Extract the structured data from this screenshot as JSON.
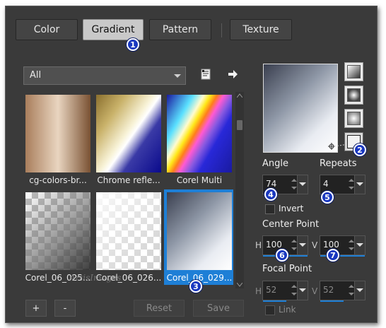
{
  "tabs": [
    {
      "label": "Color",
      "active": false
    },
    {
      "label": "Gradient",
      "active": true
    },
    {
      "label": "Pattern",
      "active": false
    },
    {
      "label": "Texture",
      "active": false
    }
  ],
  "filter": {
    "selected": "All"
  },
  "thumbnails": [
    {
      "caption": "cg-colors-br...",
      "selected": false
    },
    {
      "caption": "Chrome refle...",
      "selected": false
    },
    {
      "caption": "Corel Multi",
      "selected": false
    },
    {
      "caption": "Corel_06_025...",
      "selected": false
    },
    {
      "caption": "Corel_06_026...",
      "selected": false
    },
    {
      "caption": "Corel_06_029...",
      "selected": true
    }
  ],
  "bottom_buttons": {
    "add": "+",
    "remove": "-",
    "reset": "Reset",
    "save": "Save"
  },
  "angle": {
    "label": "Angle",
    "value": "74"
  },
  "repeats": {
    "label": "Repeats",
    "value": "4"
  },
  "invert": {
    "label": "Invert",
    "checked": false
  },
  "center_point": {
    "label": "Center Point",
    "h_label": "H",
    "h_value": "100",
    "v_label": "V",
    "v_value": "100"
  },
  "focal_point": {
    "label": "Focal Point",
    "h_label": "H",
    "h_value": "52",
    "v_label": "V",
    "v_value": "52"
  },
  "link": {
    "label": "Link",
    "checked": false
  },
  "badges": [
    "1",
    "2",
    "3",
    "4",
    "5",
    "6",
    "7"
  ],
  "watermark": "ArtisImages",
  "colors": {
    "accent": "#1e7fd6",
    "badge": "#1a38c0",
    "panel": "#3a3a3a"
  }
}
